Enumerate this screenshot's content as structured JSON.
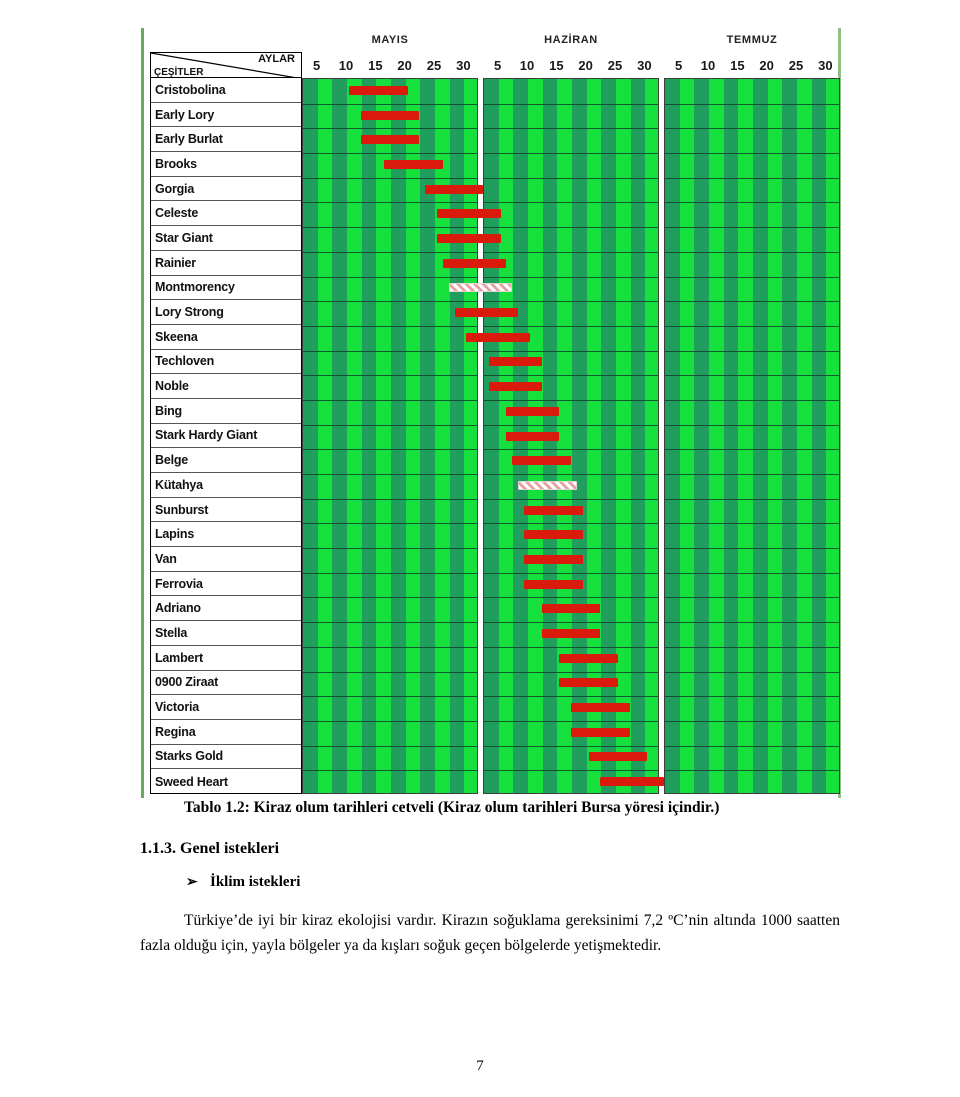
{
  "document": {
    "page_number": "7",
    "caption": "Tablo 1.2: Kiraz olum tarihleri cetveli (Kiraz olum tarihleri Bursa yöresi içindir.)",
    "section_heading": "1.1.3. Genel istekleri",
    "bullet_glyph": "➢",
    "bullet_label": "İklim istekleri",
    "paragraph": "Türkiye’de iyi bir kiraz ekolojisi vardır. Kirazın soğuklama gereksinimi 7,2 ºC’nin altında 1000 saatten fazla olduğu için, yayla bölgeler ya da kışları soğuk geçen bölgelerde yetişmektedir."
  },
  "chart_data": {
    "type": "bar",
    "title": "Kiraz olum tarihleri cetveli",
    "xlabel": "AYLAR",
    "ylabel": "ÇEŞİTLER",
    "corner_row_label": "ÇEŞİTLER",
    "corner_col_label": "AYLAR",
    "months": [
      "MAYIS",
      "HAZİRAN",
      "TEMMUZ"
    ],
    "day_ticks": [
      5,
      10,
      15,
      20,
      25,
      30
    ],
    "x_axis_note": "Each month panel spans days 1-30; positions given as day-of-year offset from 1 May (day 0).",
    "xlim": [
      0,
      90
    ],
    "grid": true,
    "legend": "none",
    "colors": {
      "bar": "#d91a0d",
      "stripe_dark": "#1f9e5e",
      "stripe_light": "#16e13c",
      "hatched_bar": "#ffffff",
      "border": "#3d3d3d"
    },
    "categories": [
      "Cristobolina",
      "Early Lory",
      "Early Burlat",
      "Brooks",
      "Gorgia",
      "Celeste",
      "Star Giant",
      "Rainier",
      "Montmorency",
      "Lory Strong",
      "Skeena",
      "Techloven",
      "Noble",
      "Bing",
      "Stark Hardy Giant",
      "Belge",
      "Kütahya",
      "Sunburst",
      "Lapins",
      "Van",
      "Ferrovia",
      "Adriano",
      "Stella",
      "Lambert",
      "0900 Ziraat",
      "Victoria",
      "Regina",
      "Starks Gold",
      "Sweed Heart"
    ],
    "bars": [
      {
        "variety": "Cristobolina",
        "start_day": 8,
        "end_day": 18,
        "month_start": "MAYIS",
        "style": "solid"
      },
      {
        "variety": "Early Lory",
        "start_day": 10,
        "end_day": 20,
        "month_start": "MAYIS",
        "style": "solid"
      },
      {
        "variety": "Early Burlat",
        "start_day": 10,
        "end_day": 20,
        "month_start": "MAYIS",
        "style": "solid"
      },
      {
        "variety": "Brooks",
        "start_day": 14,
        "end_day": 24,
        "month_start": "MAYIS",
        "style": "solid"
      },
      {
        "variety": "Gorgia",
        "start_day": 21,
        "end_day": 30,
        "month_start": "MAYIS",
        "style": "solid"
      },
      {
        "variety": "Celeste",
        "start_day": 23,
        "end_day": 33,
        "month_start": "MAYIS",
        "style": "solid"
      },
      {
        "variety": "Star Giant",
        "start_day": 23,
        "end_day": 33,
        "month_start": "MAYIS",
        "style": "solid"
      },
      {
        "variety": "Rainier",
        "start_day": 24,
        "end_day": 34,
        "month_start": "MAYIS",
        "style": "solid"
      },
      {
        "variety": "Montmorency",
        "start_day": 25,
        "end_day": 35,
        "month_start": "MAYIS",
        "style": "hatched"
      },
      {
        "variety": "Lory Strong",
        "start_day": 26,
        "end_day": 36,
        "month_start": "MAYIS",
        "style": "solid"
      },
      {
        "variety": "Skeena",
        "start_day": 28,
        "end_day": 38,
        "month_start": "MAYIS",
        "style": "solid"
      },
      {
        "variety": "Techloven",
        "start_day": 31,
        "end_day": 40,
        "month_start": "HAZİRAN",
        "style": "solid"
      },
      {
        "variety": "Noble",
        "start_day": 31,
        "end_day": 40,
        "month_start": "HAZİRAN",
        "style": "solid"
      },
      {
        "variety": "Bing",
        "start_day": 34,
        "end_day": 43,
        "month_start": "HAZİRAN",
        "style": "solid"
      },
      {
        "variety": "Stark Hardy Giant",
        "start_day": 34,
        "end_day": 43,
        "month_start": "HAZİRAN",
        "style": "solid"
      },
      {
        "variety": "Belge",
        "start_day": 35,
        "end_day": 45,
        "month_start": "HAZİRAN",
        "style": "solid"
      },
      {
        "variety": "Kütahya",
        "start_day": 36,
        "end_day": 46,
        "month_start": "HAZİRAN",
        "style": "hatched"
      },
      {
        "variety": "Sunburst",
        "start_day": 37,
        "end_day": 47,
        "month_start": "HAZİRAN",
        "style": "solid"
      },
      {
        "variety": "Lapins",
        "start_day": 37,
        "end_day": 47,
        "month_start": "HAZİRAN",
        "style": "solid"
      },
      {
        "variety": "Van",
        "start_day": 37,
        "end_day": 47,
        "month_start": "HAZİRAN",
        "style": "solid"
      },
      {
        "variety": "Ferrovia",
        "start_day": 37,
        "end_day": 47,
        "month_start": "HAZİRAN",
        "style": "solid"
      },
      {
        "variety": "Adriano",
        "start_day": 40,
        "end_day": 50,
        "month_start": "HAZİRAN",
        "style": "solid"
      },
      {
        "variety": "Stella",
        "start_day": 40,
        "end_day": 50,
        "month_start": "HAZİRAN",
        "style": "solid"
      },
      {
        "variety": "Lambert",
        "start_day": 43,
        "end_day": 53,
        "month_start": "HAZİRAN",
        "style": "solid"
      },
      {
        "variety": "0900 Ziraat",
        "start_day": 43,
        "end_day": 53,
        "month_start": "HAZİRAN",
        "style": "solid"
      },
      {
        "variety": "Victoria",
        "start_day": 45,
        "end_day": 55,
        "month_start": "HAZİRAN",
        "style": "solid"
      },
      {
        "variety": "Regina",
        "start_day": 45,
        "end_day": 55,
        "month_start": "HAZİRAN",
        "style": "solid"
      },
      {
        "variety": "Starks Gold",
        "start_day": 48,
        "end_day": 58,
        "month_start": "HAZİRAN",
        "style": "solid"
      },
      {
        "variety": "Sweed Heart",
        "start_day": 50,
        "end_day": 60,
        "month_start": "TEMMUZ",
        "style": "solid"
      }
    ]
  }
}
